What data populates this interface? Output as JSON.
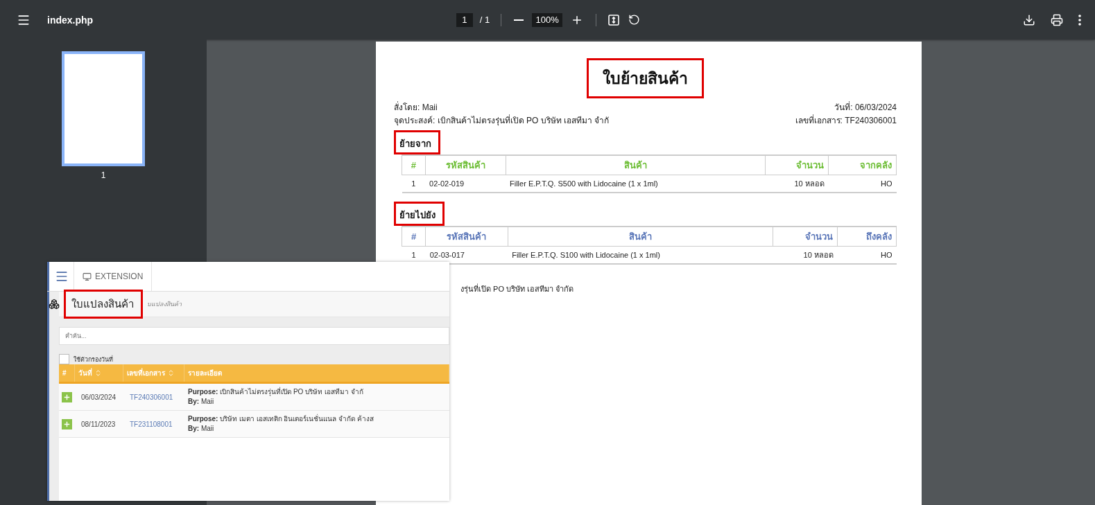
{
  "toolbar": {
    "filename": "index.php",
    "page_current": "1",
    "page_total": "/ 1",
    "zoom": "100%"
  },
  "sidebar": {
    "thumbnails": [
      {
        "label": "1",
        "selected": true
      }
    ]
  },
  "document": {
    "title": {
      "text": "ใบย้ายสินค้า",
      "highlighted": true
    },
    "info_left": [
      "สั่งโดย: Maii",
      "จุดประสงค์: เบิกสินค้าไม่ตรงรุ่นที่เปิด PO บริษัท เอสทีมา จำกั"
    ],
    "info_right": [
      "วันที่: 06/03/2024",
      "เลขที่เอกสาร: TF240306001"
    ],
    "sections": [
      {
        "heading": "ย้ายจาก",
        "highlighted": true,
        "color": "#6cbd34",
        "columns": [
          "#",
          "รหัสสินค้า",
          "สินค้า",
          "จำนวน",
          "จากคลัง"
        ],
        "rows": [
          [
            "1",
            "02-02-019",
            "Filler E.P.T.Q. S500 with Lidocaine (1 x 1ml)",
            "10 หลอด",
            "HO"
          ]
        ]
      },
      {
        "heading": "ย้ายไปยัง",
        "highlighted": true,
        "color": "#5a76b8",
        "columns": [
          "#",
          "รหัสสินค้า",
          "สินค้า",
          "จำนวน",
          "ถึงคลัง"
        ],
        "rows": [
          [
            "1",
            "02-03-017",
            "Filler E.P.T.Q. S100 with Lidocaine (1 x 1ml)",
            "10 หลอด",
            "HO"
          ]
        ]
      }
    ],
    "note": "งรุ่นที่เปิด PO บริษัท เอสทีมา จำกัด"
  },
  "overlay": {
    "nav": {
      "tab": "EXTENSION"
    },
    "title": {
      "text": "ใบแปลงสินค้า",
      "highlighted": true
    },
    "breadcrumb": "บแปลงสินค้า",
    "search": {
      "placeholder": "คำค้น..."
    },
    "date_filter": {
      "label": "ใช้ตัวกรองวันที่",
      "checked": false
    },
    "table": {
      "columns": [
        {
          "label": "#",
          "sortable": false
        },
        {
          "label": "วันที่",
          "sortable": true
        },
        {
          "label": "เลขที่เอกสาร",
          "sortable": true
        },
        {
          "label": "รายละเอียด",
          "sortable": false
        }
      ],
      "rows": [
        {
          "date": "06/03/2024",
          "doc_no": "TF240306001",
          "purpose": "**Purpose:** เบิกสินค้าไม่ตรงรุ่นที่เปิด PO บริษัท เอสทีมา จำกั",
          "by": "**By:** Maii"
        },
        {
          "date": "08/11/2023",
          "doc_no": "TF231108001",
          "purpose": "**Purpose:** บริษัท เมตา เอสเทติก อินเตอร์เนชั่นแนล จำกัด ค้างส",
          "by": "**By:** Maii"
        }
      ]
    }
  }
}
